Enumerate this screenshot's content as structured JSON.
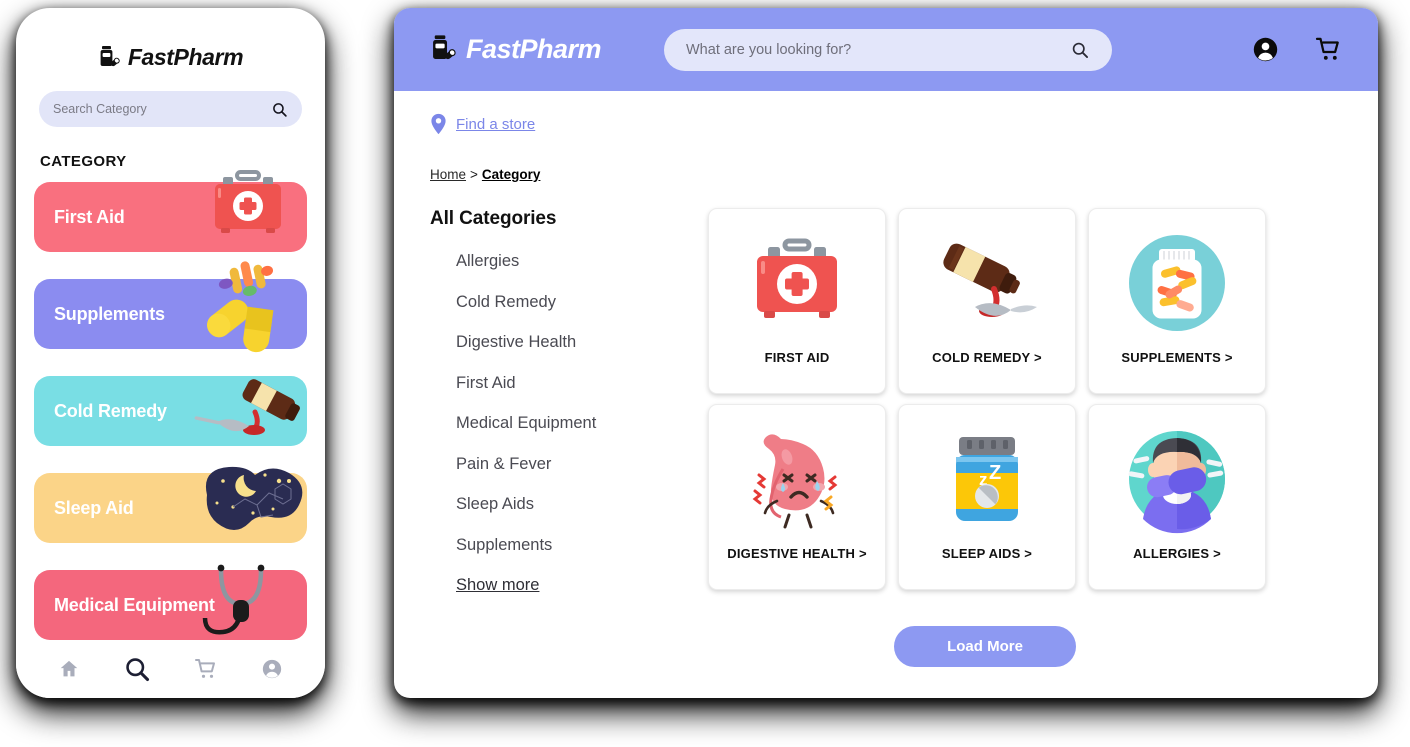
{
  "brand": {
    "name": "FastPharm",
    "logo_icon": "pill-bottle-icon",
    "header_color": "#8d99f2",
    "search_field_color": "#e3e6fa",
    "accent_color": "#7b86e8"
  },
  "mobile": {
    "search": {
      "placeholder": "Search Category",
      "value": "",
      "icon": "search-icon"
    },
    "section_title": "CATEGORY",
    "cards": [
      {
        "label": "First Aid",
        "color": "#f9707f",
        "art": "first-aid-kit-illustration"
      },
      {
        "label": "Supplements",
        "color": "#8b8cf0",
        "art": "capsule-vegetables-illustration"
      },
      {
        "label": "Cold Remedy",
        "color": "#79dee4",
        "art": "syrup-bottle-spoon-illustration"
      },
      {
        "label": "Sleep Aid",
        "color": "#fbd488",
        "art": "night-sky-moon-illustration"
      },
      {
        "label": "Medical Equipment",
        "color": "#f4677d",
        "art": "stethoscope-illustration"
      }
    ],
    "bottom_nav": [
      {
        "name": "home",
        "icon": "home-icon",
        "active": false
      },
      {
        "name": "search",
        "icon": "search-icon",
        "active": true
      },
      {
        "name": "cart",
        "icon": "cart-icon",
        "active": false
      },
      {
        "name": "account",
        "icon": "account-icon",
        "active": false
      }
    ]
  },
  "desktop": {
    "search": {
      "placeholder": "What are you looking for?",
      "value": "",
      "icon": "search-icon"
    },
    "header_icons": [
      {
        "name": "account",
        "icon": "account-icon"
      },
      {
        "name": "cart",
        "icon": "cart-icon"
      }
    ],
    "find_store": {
      "label": "Find a store",
      "icon": "location-pin-icon"
    },
    "breadcrumb": {
      "home": "Home",
      "separator": ">",
      "current": "Category"
    },
    "sidebar": {
      "title": "All Categories",
      "items": [
        "Allergies",
        "Cold Remedy",
        "Digestive Health",
        "First Aid",
        "Medical Equipment",
        "Pain & Fever",
        "Sleep Aids",
        "Supplements"
      ],
      "show_more": "Show more"
    },
    "tiles": [
      {
        "caption": "FIRST AID",
        "art": "first-aid-kit-illustration"
      },
      {
        "caption": "COLD REMEDY >",
        "art": "syrup-bottle-spoon-illustration"
      },
      {
        "caption": "SUPPLEMENTS >",
        "art": "pill-bottle-capsules-illustration"
      },
      {
        "caption": "DIGESTIVE HEALTH >",
        "art": "crying-stomach-illustration"
      },
      {
        "caption": "SLEEP AIDS >",
        "art": "sleep-pill-bottle-illustration"
      },
      {
        "caption": "ALLERGIES >",
        "art": "sneezing-person-illustration"
      }
    ],
    "load_more_label": "Load More"
  }
}
